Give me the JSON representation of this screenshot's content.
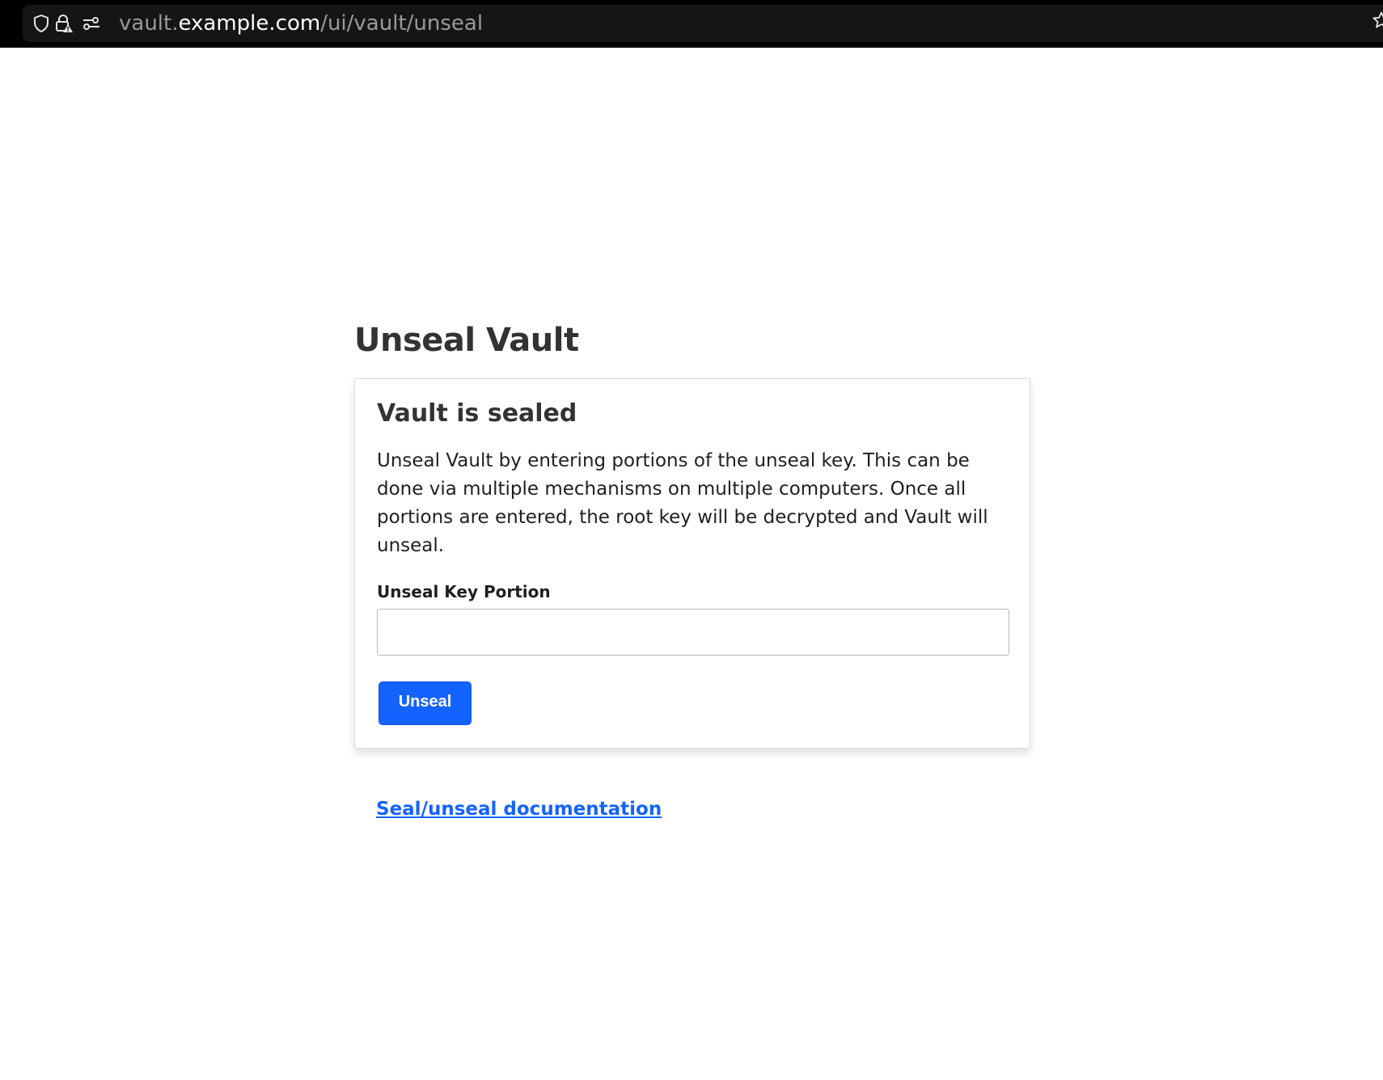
{
  "browser": {
    "url_prefix": "vault.",
    "url_host": "example.com",
    "url_path": "/ui/vault/unseal",
    "icons": [
      "shield-icon",
      "lock-warning-icon",
      "page-settings-icon",
      "star-icon"
    ]
  },
  "page": {
    "title": "Unseal Vault"
  },
  "card": {
    "heading": "Vault is sealed",
    "description": "Unseal Vault by entering portions of the unseal key. This can be done via multiple mechanisms on multiple computers. Once all portions are entered, the root key will be decrypted and Vault will unseal.",
    "field_label": "Unseal Key Portion",
    "field_value": "",
    "button_label": "Unseal"
  },
  "footer": {
    "doc_link": "Seal/unseal documentation"
  },
  "colors": {
    "accent": "#1563ff",
    "heading": "#333333",
    "browser_bar": "#000000"
  }
}
